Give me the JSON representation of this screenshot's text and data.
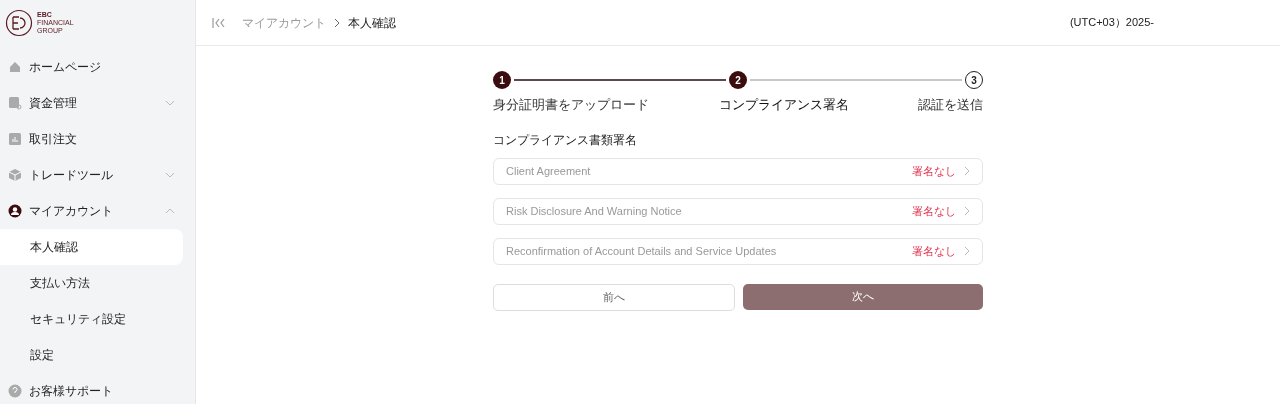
{
  "logo": {
    "line_1": "EBC",
    "line_2": "FINANCIAL",
    "line_3": "GROUP"
  },
  "sidebar": {
    "items": [
      {
        "label": "ホームページ",
        "selected": false
      },
      {
        "label": "資金管理",
        "selected": false,
        "expanded": false
      },
      {
        "label": "取引注文",
        "selected": false
      },
      {
        "label": "トレードツール",
        "selected": false,
        "expanded": false
      },
      {
        "label": "マイアカウント",
        "selected": false,
        "expanded": true,
        "children": [
          {
            "label": "本人確認",
            "selected": true
          },
          {
            "label": "支払い方法",
            "selected": false
          },
          {
            "label": "セキュリティ設定",
            "selected": false
          },
          {
            "label": "設定",
            "selected": false
          }
        ]
      },
      {
        "label": "お客様サポート",
        "selected": false
      }
    ]
  },
  "breadcrumb": [
    {
      "label": "マイアカウント"
    },
    {
      "label": "本人確認"
    }
  ],
  "header": {
    "time": "(UTC+03）2025-"
  },
  "steps": [
    {
      "number": "1",
      "label": "身分証明書をアップロード",
      "selected": false
    },
    {
      "number": "2",
      "label": "コンプライアンス署名",
      "selected": true
    },
    {
      "number": "3",
      "label": "認証を送信",
      "selected": false
    }
  ],
  "section_title": "コンプライアンス書類署名",
  "documents": [
    {
      "name": "Client Agreement",
      "status": "署名なし"
    },
    {
      "name": "Risk Disclosure And Warning Notice",
      "status": "署名なし"
    },
    {
      "name": "Reconfirmation of Account Details and Service Updates",
      "status": "署名なし"
    }
  ],
  "buttons": {
    "previous": "前へ",
    "next": "次へ"
  }
}
